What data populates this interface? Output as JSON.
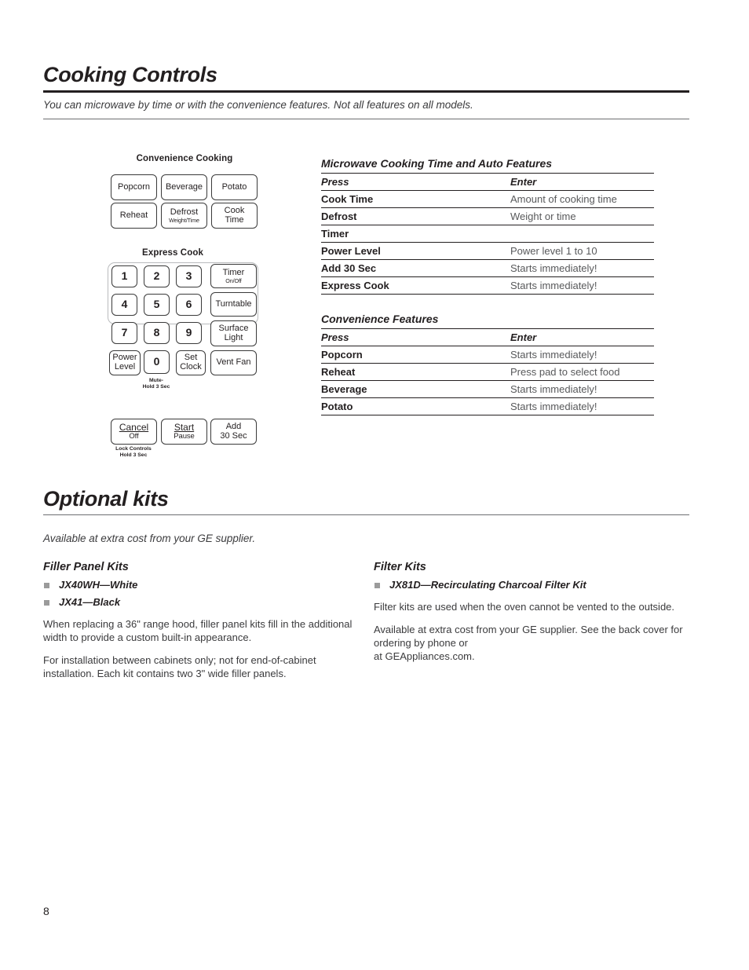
{
  "sections": {
    "cooking_controls": {
      "title": "Cooking Controls",
      "subtitle": "You can microwave by time or with the convenience features. Not all features on all models."
    },
    "optional_kits": {
      "title": "Optional kits",
      "availability": "Available at extra cost from your GE supplier."
    }
  },
  "keypad": {
    "convenience_label": "Convenience Cooking",
    "express_label": "Express Cook",
    "convenience_buttons": [
      {
        "l1": "Popcorn",
        "l2": ""
      },
      {
        "l1": "Beverage",
        "l2": ""
      },
      {
        "l1": "Potato",
        "l2": ""
      },
      {
        "l1": "Reheat",
        "l2": ""
      },
      {
        "l1": "Defrost",
        "l2": "Weight/Time"
      },
      {
        "l1": "Cook",
        "l2": "Time"
      }
    ],
    "number_keys": [
      "1",
      "2",
      "3",
      "4",
      "5",
      "6",
      "7",
      "8",
      "9"
    ],
    "power_level": {
      "l1": "Power",
      "l2": "Level"
    },
    "zero_key": "0",
    "set_clock": {
      "l1": "Set",
      "l2": "Clock"
    },
    "side_buttons": [
      {
        "l1": "Timer",
        "l2": "On/Off"
      },
      {
        "l1": "Turntable",
        "l2": ""
      },
      {
        "l1": "Surface",
        "l2": "Light"
      },
      {
        "l1": "Vent Fan",
        "l2": ""
      }
    ],
    "mute_note": "Mute-\nHold 3 Sec",
    "mute_note_line1": "Mute-",
    "mute_note_line2": "Hold 3 Sec",
    "action_buttons": [
      {
        "l1": "Cancel",
        "l2": "Off"
      },
      {
        "l1": "Start",
        "l2": "Pause"
      },
      {
        "l1": "Add",
        "l2": "30 Sec"
      }
    ],
    "lock_note_line1": "Lock Controls",
    "lock_note_line2": "Hold 3 Sec"
  },
  "tables": {
    "microwave": {
      "title": "Microwave Cooking Time and Auto Features",
      "headers": [
        "Press",
        "Enter"
      ],
      "rows": [
        [
          "Cook Time",
          "Amount of cooking time"
        ],
        [
          "Defrost",
          "Weight or time"
        ],
        [
          "Timer",
          ""
        ],
        [
          "Power Level",
          "Power level 1 to 10"
        ],
        [
          "Add 30 Sec",
          "Starts immediately!"
        ],
        [
          "Express Cook",
          "Starts immediately!"
        ]
      ]
    },
    "convenience": {
      "title": "Convenience Features",
      "headers": [
        "Press",
        "Enter"
      ],
      "rows": [
        [
          "Popcorn",
          "Starts immediately!"
        ],
        [
          "Reheat",
          "Press pad to select food"
        ],
        [
          "Beverage",
          "Starts immediately!"
        ],
        [
          "Potato",
          "Starts immediately!"
        ]
      ]
    }
  },
  "filler_panel_kits": {
    "heading": "Filler Panel Kits",
    "items": [
      "JX40WH—White",
      "JX41—Black"
    ],
    "paragraphs": [
      "When replacing a 36\" range hood, filler panel kits fill in the additional width to provide a custom built-in appearance.",
      "For installation between cabinets only; not for end-of-cabinet installation. Each kit contains two 3\" wide filler panels."
    ]
  },
  "filter_kits": {
    "heading": "Filter Kits",
    "items": [
      "JX81D—Recirculating Charcoal Filter Kit"
    ],
    "paragraphs": [
      "Filter kits are used when the oven cannot be vented to the outside.",
      "Available at extra cost from your GE supplier. See the back cover for ordering by phone or\nat GEAppliances.com."
    ]
  },
  "page_number": "8",
  "colors": {
    "ink": "#231f20",
    "body_gray": "#3b3b3d",
    "table_value_gray": "#58595b",
    "bullet_gray": "#9b9b9b",
    "bracket_gray": "#b9bbbd"
  }
}
